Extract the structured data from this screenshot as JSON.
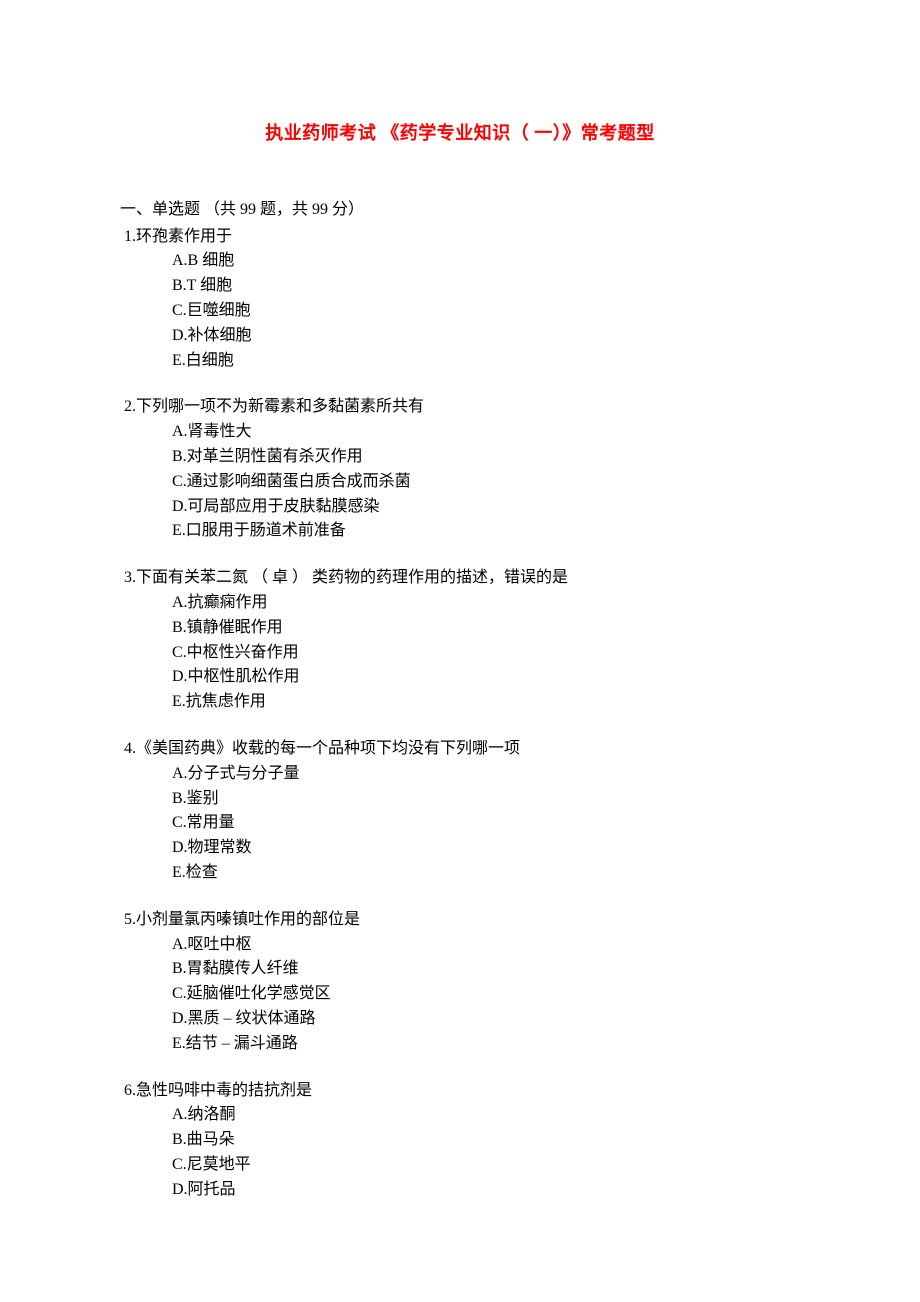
{
  "title": "执业药师考试 《药学专业知识（ 一）》常考题型",
  "section_header": "一、单选题 （共 99 题，共 99 分）",
  "questions": [
    {
      "num": "1.",
      "stem": "环孢素作用于",
      "options": [
        "A.B 细胞",
        "B.T 细胞",
        "C.巨噬细胞",
        "D.补体细胞",
        "E.白细胞"
      ]
    },
    {
      "num": "2.",
      "stem": "下列哪一项不为新霉素和多黏菌素所共有",
      "options": [
        "A.肾毒性大",
        "B.对革兰阴性菌有杀灭作用",
        "C.通过影响细菌蛋白质合成而杀菌",
        "D.可局部应用于皮肤黏膜感染",
        "E.口服用于肠道术前准备"
      ]
    },
    {
      "num": "3.",
      "stem": "下面有关苯二氮 （ 卓 ） 类药物的药理作用的描述，错误的是",
      "options": [
        "A.抗癫痫作用",
        "B.镇静催眠作用",
        "C.中枢性兴奋作用",
        "D.中枢性肌松作用",
        "E.抗焦虑作用"
      ]
    },
    {
      "num": "4.",
      "stem": "《美国药典》收载的每一个品种项下均没有下列哪一项",
      "options": [
        "A.分子式与分子量",
        "B.鉴别",
        "C.常用量",
        "D.物理常数",
        "E.检查"
      ]
    },
    {
      "num": "5.",
      "stem": "小剂量氯丙嗪镇吐作用的部位是",
      "options": [
        "A.呕吐中枢",
        "B.胃黏膜传人纤维",
        "C.延脑催吐化学感觉区",
        "D.黑质 – 纹状体通路",
        "E.结节 – 漏斗通路"
      ]
    },
    {
      "num": "6.",
      "stem": "急性吗啡中毒的拮抗剂是",
      "options": [
        "A.纳洛酮",
        "B.曲马朵",
        "C.尼莫地平",
        "D.阿托品"
      ]
    }
  ]
}
